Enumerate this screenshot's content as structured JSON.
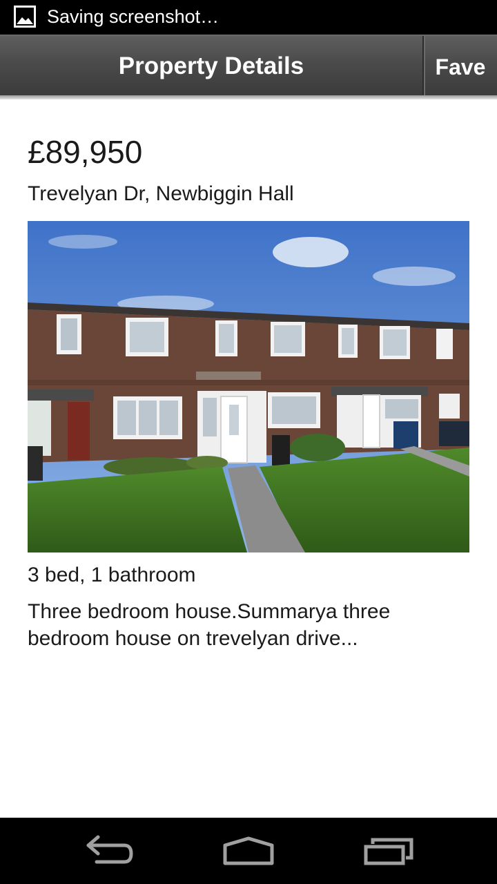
{
  "status_bar": {
    "icon": "image-icon",
    "notification_text": "Saving screenshot…"
  },
  "action_bar": {
    "title": "Property Details",
    "fave_label": "Fave"
  },
  "listing": {
    "price": "£89,950",
    "address": "Trevelyan Dr, Newbiggin Hall",
    "photo_description": "",
    "rooms": "3 bed, 1 bathroom",
    "summary": "Three bedroom house.Summarya three bedroom house on trevelyan drive..."
  },
  "nav_bar": {
    "back_icon": "back-icon",
    "home_icon": "home-icon",
    "recents_icon": "recent-apps-icon"
  },
  "colors": {
    "status_bar_bg": "#000000",
    "action_bar_bg": "#4a4a4a",
    "text": "#1a1a1a",
    "nav_icon": "#a0a0a0"
  }
}
